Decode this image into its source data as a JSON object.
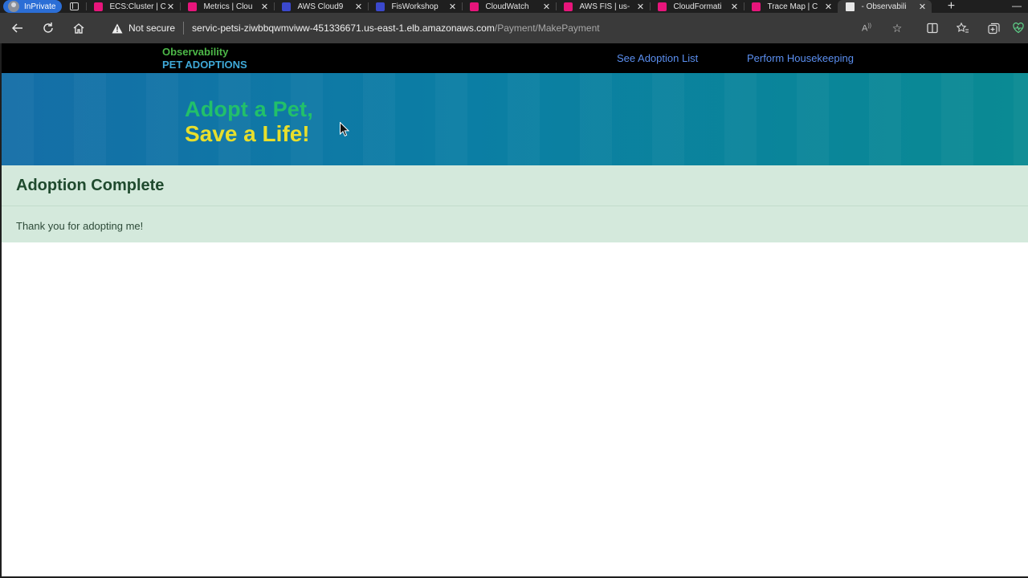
{
  "browser": {
    "profile_label": "InPrivate",
    "tabs": [
      {
        "title": "ECS:Cluster | C",
        "icon": "cloudwatch-icon",
        "active": false
      },
      {
        "title": "Metrics | Clou",
        "icon": "cloudwatch-icon",
        "active": false
      },
      {
        "title": "AWS Cloud9",
        "icon": "cloud9-icon",
        "active": false
      },
      {
        "title": "FisWorkshop",
        "icon": "cloud9-icon",
        "active": false
      },
      {
        "title": "CloudWatch",
        "icon": "cloudwatch-icon",
        "active": false
      },
      {
        "title": "AWS FIS | us-",
        "icon": "fis-icon",
        "active": false
      },
      {
        "title": "CloudFormati",
        "icon": "cloudformation-icon",
        "active": false
      },
      {
        "title": "Trace Map | C",
        "icon": "cloudwatch-icon",
        "active": false
      },
      {
        "title": "- Observabili",
        "icon": "document-icon",
        "active": true
      }
    ],
    "security_label": "Not secure",
    "url_host": "servic-petsi-ziwbbqwmviww-451336671.us-east-1.elb.amazonaws.com",
    "url_path": "/Payment/MakePayment"
  },
  "site": {
    "brand_line1": "Observability",
    "brand_line2": "PET ADOPTIONS",
    "nav": [
      {
        "label": "See Adoption List"
      },
      {
        "label": "Perform Housekeeping"
      }
    ],
    "hero_line1": "Adopt a Pet,",
    "hero_line2": "Save a Life!"
  },
  "status": {
    "heading": "Adoption Complete",
    "message": "Thank you for adopting me!"
  }
}
